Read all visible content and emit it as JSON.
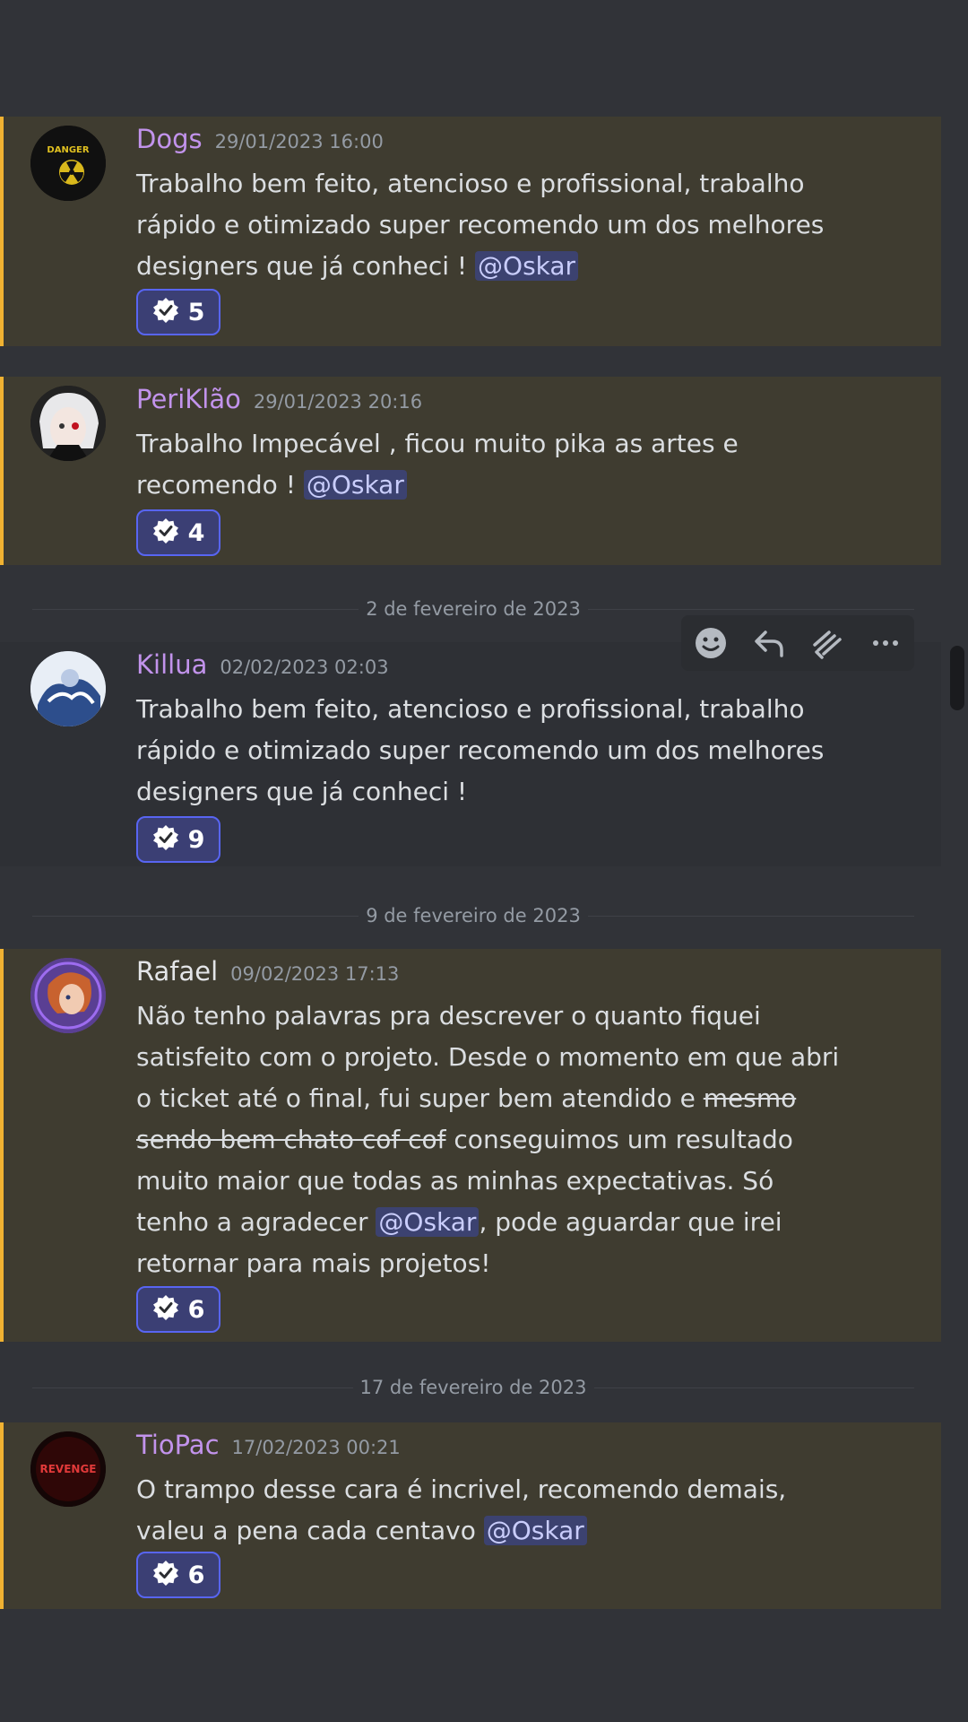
{
  "colors": {
    "background": "#313338",
    "highlight": "#3f3c30",
    "highlight_bar": "#f0b232",
    "mention_bg": "#3c4270",
    "reaction_border": "#5865f2"
  },
  "messages": [
    {
      "username": "Dogs",
      "username_color": "#c293ec",
      "timestamp": "29/01/2023 16:00",
      "avatar_text": "DANGER",
      "text": "Trabalho bem feito, atencioso e profissional, trabalho rápido e otimizado super recomendo um dos melhores designers que já conheci ! ",
      "mention": "@Oskar",
      "reaction_icon": "check-badge-icon",
      "reaction_count": "5"
    },
    {
      "username": "PeriKlão",
      "username_color": "#c293ec",
      "timestamp": "29/01/2023 20:16",
      "text": "Trabalho Impecável , ficou muito pika as artes e recomendo ! ",
      "mention": "@Oskar",
      "reaction_icon": "check-badge-icon",
      "reaction_count": "4"
    },
    {
      "username": "Killua",
      "username_color": "#c293ec",
      "timestamp": "02/02/2023 02:03",
      "text": "Trabalho bem feito, atencioso e profissional, trabalho rápido e otimizado super recomendo um dos melhores designers que já conheci !",
      "reaction_icon": "check-badge-icon",
      "reaction_count": "9"
    },
    {
      "username": "Rafael",
      "username_color": "#e3e5e8",
      "timestamp": "09/02/2023 17:13",
      "text_a": "Não tenho palavras pra descrever o quanto fiquei satisfeito com o projeto. Desde o momento em que abri o ticket até o final, fui super bem atendido e ",
      "text_strike": "mesmo sendo bem chato cof cof",
      "text_b": " conseguimos um resultado muito maior que todas as minhas expectativas. Só tenho a agradecer ",
      "mention": "@Oskar",
      "text_c": ", pode aguardar que irei retornar para mais projetos!",
      "reaction_icon": "check-badge-icon",
      "reaction_count": "6"
    },
    {
      "username": "TioPac",
      "username_color": "#c293ec",
      "timestamp": "17/02/2023 00:21",
      "avatar_text": "REVENGE",
      "text": "O trampo desse cara é incrivel, recomendo demais, valeu a pena cada centavo ",
      "mention": "@Oskar",
      "reaction_icon": "check-badge-icon",
      "reaction_count": "6"
    }
  ],
  "dividers": [
    "2 de fevereiro de 2023",
    "9 de fevereiro de 2023",
    "17 de fevereiro de 2023"
  ],
  "toolbar": {
    "icons": [
      "add-reaction-icon",
      "reply-icon",
      "thread-icon",
      "more-icon"
    ]
  }
}
